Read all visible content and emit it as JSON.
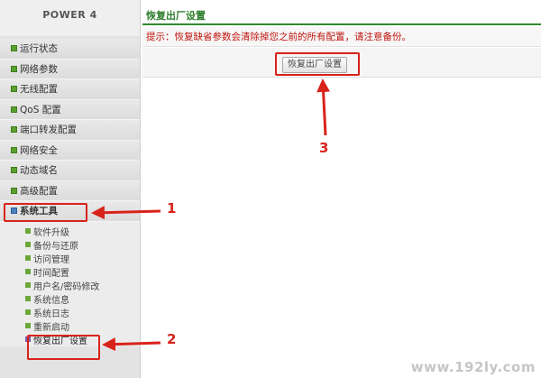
{
  "sidebar": {
    "brand": "POWER 4",
    "menu": [
      {
        "label": "运行状态"
      },
      {
        "label": "网络参数"
      },
      {
        "label": "无线配置"
      },
      {
        "label": "QoS 配置"
      },
      {
        "label": "端口转发配置"
      },
      {
        "label": "网络安全"
      },
      {
        "label": "动态域名"
      },
      {
        "label": "高级配置"
      },
      {
        "label": "系统工具"
      }
    ],
    "submenu": [
      {
        "label": "软件升级"
      },
      {
        "label": "备份与还原"
      },
      {
        "label": "访问管理"
      },
      {
        "label": "时间配置"
      },
      {
        "label": "用户名/密码修改"
      },
      {
        "label": "系统信息"
      },
      {
        "label": "系统日志"
      },
      {
        "label": "重新启动"
      },
      {
        "label": "恢复出厂设置"
      }
    ]
  },
  "main": {
    "title": "恢复出厂设置",
    "notice": "提示：恢复缺省参数会清除掉您之前的所有配置，请注意备份。",
    "reset_button": "恢复出厂设置"
  },
  "callouts": {
    "one": "1",
    "two": "2",
    "three": "3"
  },
  "watermark": "www.192ly.com",
  "colors": {
    "annotation_red": "#d8231b",
    "title_green": "#2d7d2d",
    "notice_red": "#c0140e",
    "menu_bullet_green": "#5aa02c",
    "open_menu_bullet_blue": "#4c7fbf",
    "active_sub_bullet_purple": "#7b58a8"
  }
}
